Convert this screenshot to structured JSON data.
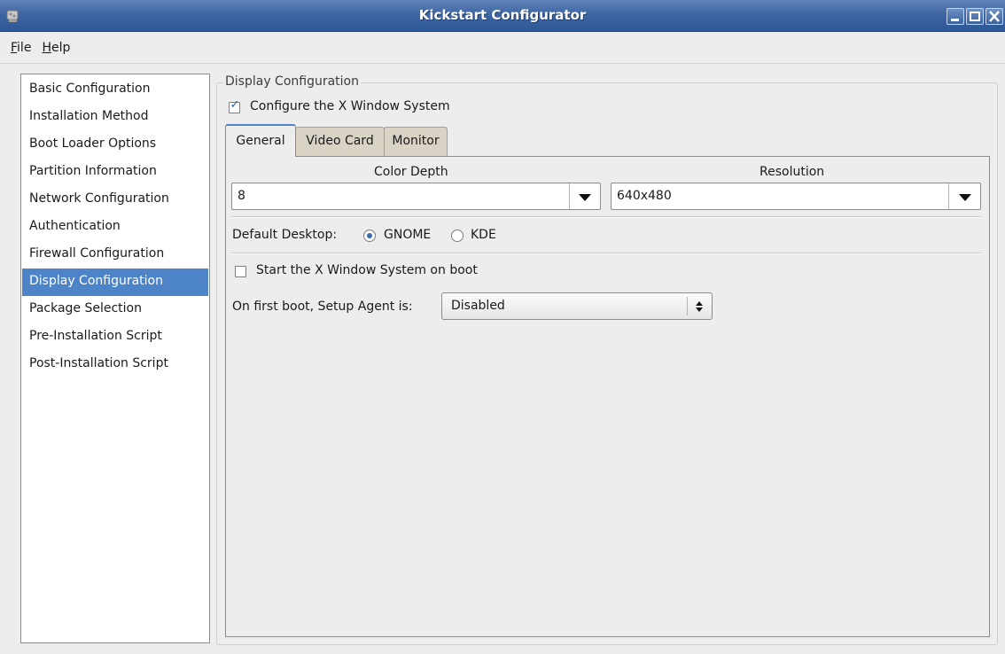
{
  "window": {
    "title": "Kickstart Configurator"
  },
  "menubar": {
    "file": {
      "mnemonic": "F",
      "rest": "ile"
    },
    "help": {
      "mnemonic": "H",
      "rest": "elp"
    }
  },
  "sidebar": {
    "items": [
      {
        "label": "Basic Configuration"
      },
      {
        "label": "Installation Method"
      },
      {
        "label": "Boot Loader Options"
      },
      {
        "label": "Partition Information"
      },
      {
        "label": "Network Configuration"
      },
      {
        "label": "Authentication"
      },
      {
        "label": "Firewall Configuration"
      },
      {
        "label": "Display Configuration",
        "selected": true
      },
      {
        "label": "Package Selection"
      },
      {
        "label": "Pre-Installation Script"
      },
      {
        "label": "Post-Installation Script"
      }
    ]
  },
  "display": {
    "frame_title": "Display Configuration",
    "configure_x": {
      "label": "Configure the X Window System",
      "checked": true
    },
    "tabs": [
      {
        "label": "General",
        "active": true
      },
      {
        "label": "Video Card"
      },
      {
        "label": "Monitor"
      }
    ],
    "general": {
      "color_depth_label": "Color Depth",
      "color_depth_value": "8",
      "resolution_label": "Resolution",
      "resolution_value": "640x480",
      "default_desktop_label": "Default Desktop:",
      "desktop_options": [
        {
          "label": "GNOME",
          "selected": true
        },
        {
          "label": "KDE",
          "selected": false
        }
      ],
      "start_x_on_boot": {
        "label": "Start the X Window System on boot",
        "checked": false
      },
      "setup_agent_label": "On first boot, Setup Agent is:",
      "setup_agent_value": "Disabled"
    }
  },
  "colors": {
    "titlebar": "#3f66a3",
    "selection": "#4d84c7",
    "background": "#ededed"
  },
  "icons": {
    "check": "✓",
    "spin": "⬍"
  }
}
